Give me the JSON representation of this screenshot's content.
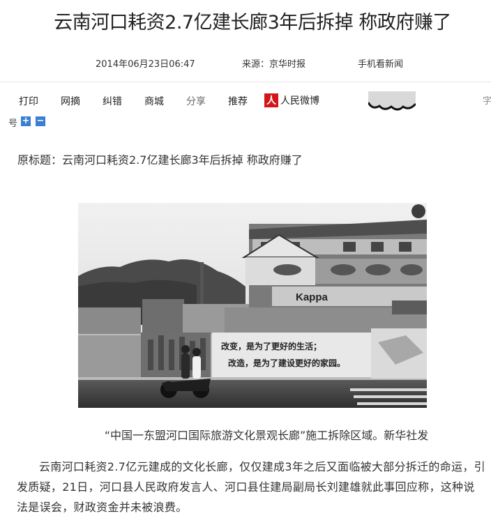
{
  "article": {
    "headline": "云南河口耗资2.7亿建长廊3年后拆掉 称政府赚了",
    "date": "2014年06月23日06:47",
    "source": "来源：京华时报",
    "mobile_link": "手机看新闻"
  },
  "toolbar": {
    "print": "打印",
    "bookmark": "网摘",
    "correction": "纠错",
    "mall": "商城",
    "share": "分享",
    "recommend": "推荐",
    "weibo_logo": "人",
    "weibo_label": "人民微博",
    "font_label_edge": "字",
    "font_label": "号",
    "font_increase": "+",
    "font_decrease": "−"
  },
  "content": {
    "original_title": "原标题：云南河口耗资2.7亿建长廊3年后拆掉 称政府赚了",
    "photo": {
      "wall_slogan_1": "改变，是为了更好的生活；",
      "wall_slogan_2": "改造，是为了建设更好的家园。",
      "store_sign": "Kappa"
    },
    "caption": "“中国一东盟河口国际旅游文化景观长廊”施工拆除区域。新华社发",
    "paragraph": "云南河口耗资2.7亿元建成的文化长廊，仅仅建成3年之后又面临被大部分拆迁的命运，引发质疑，21日，河口县人民政府发言人、河口县住建局副局长刘建雄就此事回应称，这种说法是误会，财政资金并未被浪费。"
  },
  "colors": {
    "weibo_red": "#d4161b",
    "font_button_blue": "#3a7fd0"
  },
  "icons": [
    "weibo-logo-icon",
    "cloud-icon",
    "font-increase-icon",
    "font-decrease-icon"
  ]
}
